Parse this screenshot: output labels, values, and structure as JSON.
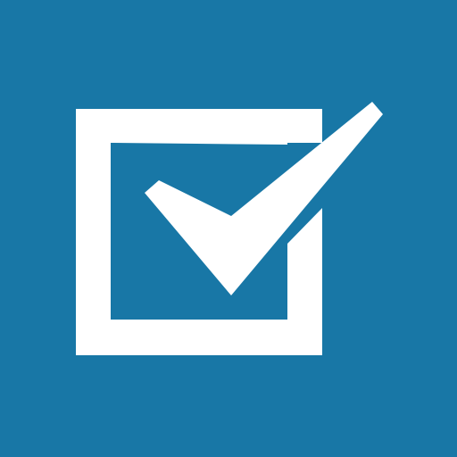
{
  "icon": {
    "name": "checkbox-checked-icon",
    "background_color": "#1877a6",
    "foreground_color": "#ffffff",
    "state": "checked"
  }
}
